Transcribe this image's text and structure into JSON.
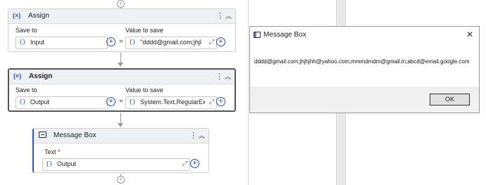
{
  "workflow": {
    "assign1": {
      "title": "Assign",
      "icon_text": "(×)",
      "save_to_label": "Save to",
      "value_to_save_label": "Value to save",
      "save_to_value": "Input",
      "value_to_save_value": "\"dddd@gmail.com;jhjl"
    },
    "assign2": {
      "title": "Assign",
      "icon_text": "(×)",
      "save_to_label": "Save to",
      "value_to_save_label": "Value to save",
      "save_to_value": "Output",
      "value_to_save_value": "System.Text.RegularEx"
    },
    "message_box": {
      "title": "Message Box",
      "text_label": "Text",
      "required_marker": "*",
      "text_value": "Output"
    },
    "brace": "{}",
    "equals": "=",
    "kebab": "⋮",
    "collapse": "︽",
    "expand": "⤢",
    "plus": "+"
  },
  "dialog": {
    "title": "Message Box",
    "close": "✕",
    "message": "dddd@gmail.com;jhjhjhh@yahoo.com;mmmdmdm@gmail.in;abcd@email.google.com",
    "ok_label": "OK"
  },
  "colors": {
    "accent": "#2b53b8",
    "selected_border": "#555555",
    "panel_border": "#d4d4d4"
  },
  "icons": {
    "dialog_window": "window-icon",
    "message_box_activity": "message-box-icon",
    "assign_activity": "assign-variable-icon"
  }
}
